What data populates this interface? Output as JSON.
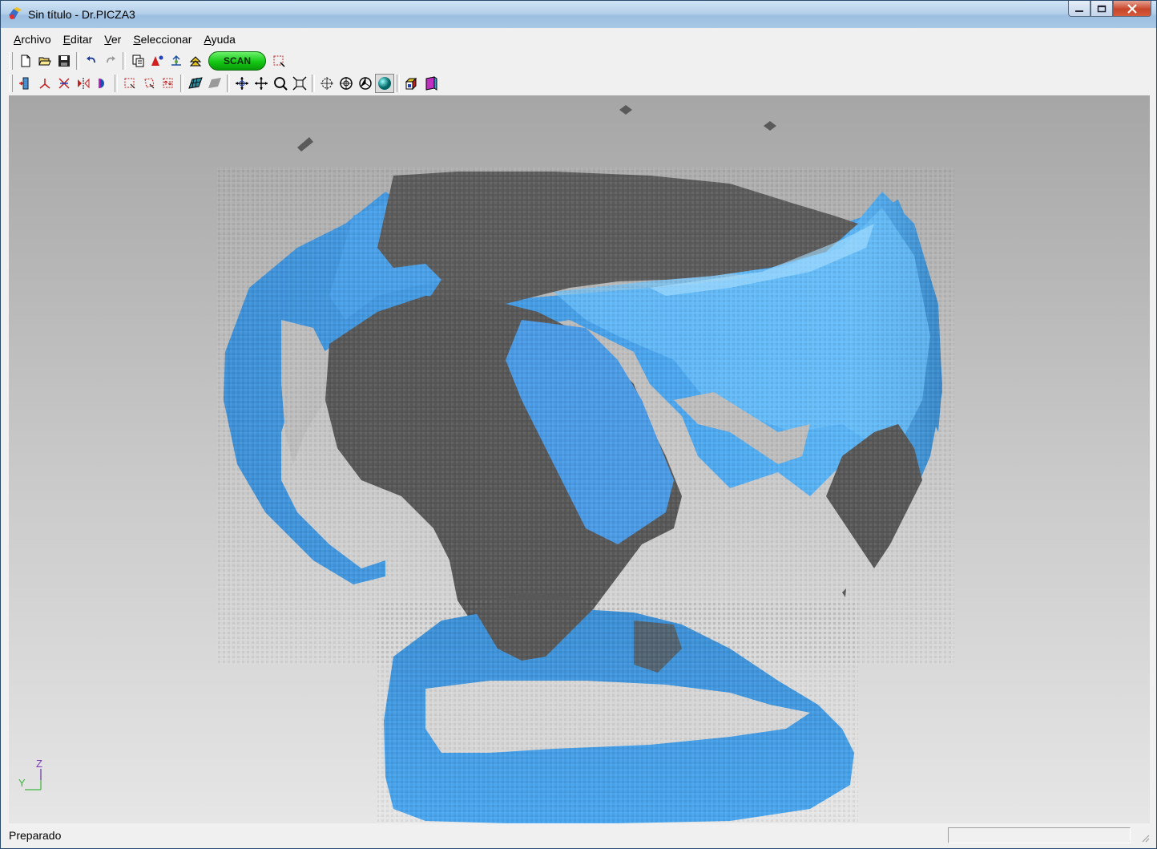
{
  "window": {
    "title": "Sin título - Dr.PICZA3",
    "controls": {
      "minimize": "minimize-icon",
      "maximize": "maximize-icon",
      "close": "close-icon"
    }
  },
  "menu": [
    {
      "key": "A",
      "rest": "rchivo"
    },
    {
      "key": "E",
      "rest": "ditar"
    },
    {
      "key": "V",
      "rest": "er"
    },
    {
      "key": "S",
      "rest": "eleccionar"
    },
    {
      "key": "A",
      "rest": "yuda"
    }
  ],
  "toolbar1": {
    "icons": [
      "new-file-icon",
      "open-folder-icon",
      "save-icon",
      "undo-icon",
      "redo-icon",
      "print-setup-icon",
      "triangle-tool-icon",
      "scan-settings-icon",
      "raise-icon"
    ],
    "scan_label": "SCAN",
    "after_scan": [
      "scan-area-icon"
    ]
  },
  "toolbar2": {
    "icons": [
      "fit-width-icon",
      "axes-icon",
      "trim-icon",
      "mirror-icon",
      "half-circle-icon",
      "select-rect-icon",
      "select-lasso-icon",
      "select-invert-icon",
      "mesh-shaded-icon",
      "mesh-flat-icon",
      "rotate-icon",
      "pan-icon",
      "zoom-icon",
      "zoom-fit-icon",
      "target-1-icon",
      "target-2-icon",
      "target-3-icon",
      "sphere-icon",
      "color-cube-icon",
      "view-box-icon"
    ]
  },
  "viewport": {
    "axis": {
      "y": "Y",
      "z": "Z"
    },
    "colors": {
      "land_light": "#4aa4ec",
      "land_dark": "#5a5a5a",
      "bg_top": "#a6a6a6",
      "bg_bottom": "#e6e6e6"
    }
  },
  "status": {
    "text": "Preparado"
  }
}
